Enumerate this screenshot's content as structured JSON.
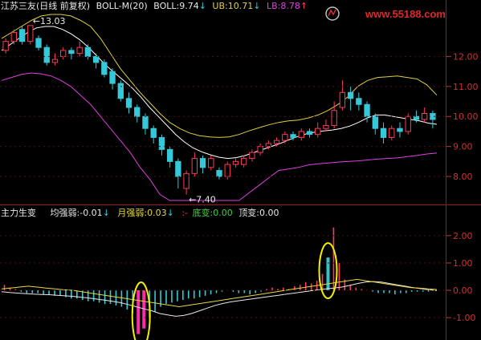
{
  "header": {
    "title": "江苏三友(日线 前复权)",
    "indicator": "BOLL-M(20)",
    "boll_label": "BOLL:",
    "boll_value": "9.74",
    "boll_arrow": "↓",
    "ub_label": "UB:",
    "ub_value": "10.71",
    "ub_arrow": "↓",
    "lb_label": "LB:",
    "lb_value": "8.78",
    "lb_arrow": "↑"
  },
  "sub_header": {
    "title": "主力生变",
    "jqr_label": "均强弱:",
    "jqr_value": "-0.01",
    "jqr_arrow": "↓",
    "yqr_label": "月强弱:",
    "yqr_value": "0.03",
    "yqr_arrow": "↓",
    "sep": ":-",
    "dibian_label": "底变:",
    "dibian_value": "0.00",
    "dingbian_label": "顶变:",
    "dingbian_value": "0.00"
  },
  "watermark": "www.55188.com",
  "colors": {
    "up": "#ff3a5a",
    "down": "#36c8d8",
    "mid": "#ffffff",
    "upper": "#e0d040",
    "lower": "#e040e0",
    "axis": "#a01818",
    "tick": "#d03030",
    "text": "#c8c8c8",
    "highlight": "#f0f000",
    "pink": "#ff2aa8",
    "teal": "#2fc4d0",
    "yellow_line": "#e8d840",
    "green": "#40d040",
    "magenta": "#e040e0"
  },
  "chart_data": [
    {
      "type": "candlestick",
      "title": "江苏三友(日线 前复权)",
      "ylim": [
        7.2,
        13.4
      ],
      "y_ticks": [
        "8.00",
        "9.00",
        "10.00",
        "11.00",
        "12.00"
      ],
      "annotations": [
        {
          "text": "13.03",
          "value": 13.03,
          "kind": "high"
        },
        {
          "text": "7.40",
          "value": 7.4,
          "kind": "low"
        }
      ],
      "mid": [
        12.2,
        12.4,
        12.6,
        12.8,
        12.95,
        13.0,
        13.0,
        12.9,
        12.75,
        12.55,
        12.3,
        12.0,
        11.7,
        11.45,
        11.2,
        10.95,
        10.65,
        10.3,
        10.0,
        9.7,
        9.4,
        9.15,
        8.95,
        8.82,
        8.72,
        8.64,
        8.6,
        8.63,
        8.7,
        8.8,
        8.9,
        9.0,
        9.1,
        9.22,
        9.33,
        9.42,
        9.48,
        9.52,
        9.55,
        9.6,
        9.68,
        9.8,
        9.95,
        10.05,
        10.05,
        10.0,
        9.95,
        9.9,
        9.85,
        9.78,
        9.74
      ],
      "upper": [
        12.6,
        12.8,
        13.0,
        13.2,
        13.35,
        13.4,
        13.4,
        13.35,
        13.2,
        13.0,
        12.6,
        12.1,
        11.6,
        11.2,
        10.8,
        10.45,
        10.1,
        9.8,
        9.6,
        9.45,
        9.36,
        9.32,
        9.3,
        9.32,
        9.4,
        9.52,
        9.62,
        9.72,
        9.8,
        9.85,
        9.88,
        9.95,
        10.05,
        10.2,
        10.4,
        10.65,
        11.0,
        11.2,
        11.3,
        11.32,
        11.35,
        11.3,
        11.25,
        11.05,
        10.71
      ],
      "lower": [
        11.2,
        11.3,
        11.4,
        11.45,
        11.42,
        11.35,
        11.2,
        11.0,
        10.7,
        10.4,
        10.0,
        9.6,
        9.2,
        8.8,
        8.3,
        7.9,
        7.4,
        7.2,
        7.2,
        7.2,
        7.2,
        7.2,
        7.2,
        7.2,
        7.2,
        7.45,
        7.7,
        7.95,
        8.2,
        8.25,
        8.3,
        8.38,
        8.42,
        8.45,
        8.48,
        8.5,
        8.52,
        8.55,
        8.58,
        8.6,
        8.62,
        8.66,
        8.7,
        8.75,
        8.78
      ],
      "candles": [
        [
          12.2,
          12.5,
          12.6,
          12.1
        ],
        [
          12.5,
          12.8,
          12.9,
          12.4
        ],
        [
          12.9,
          12.5,
          13.0,
          12.4
        ],
        [
          12.5,
          13.03,
          13.03,
          12.4
        ],
        [
          12.6,
          12.3,
          12.7,
          12.2
        ],
        [
          12.3,
          11.8,
          12.4,
          11.7
        ],
        [
          11.8,
          11.9,
          12.1,
          11.7
        ],
        [
          12.0,
          12.2,
          12.3,
          11.9
        ],
        [
          12.2,
          12.1,
          12.3,
          11.9
        ],
        [
          12.1,
          12.3,
          12.5,
          12.0
        ],
        [
          12.3,
          12.0,
          12.4,
          11.9
        ],
        [
          12.0,
          11.8,
          12.1,
          11.6
        ],
        [
          11.8,
          11.4,
          11.9,
          11.3
        ],
        [
          11.5,
          11.1,
          11.6,
          10.9
        ],
        [
          11.1,
          10.6,
          11.2,
          10.5
        ],
        [
          10.6,
          10.3,
          10.8,
          10.1
        ],
        [
          10.3,
          10.0,
          10.4,
          9.8
        ],
        [
          10.0,
          9.6,
          10.1,
          9.4
        ],
        [
          9.6,
          9.3,
          9.7,
          9.1
        ],
        [
          9.3,
          8.9,
          9.4,
          8.7
        ],
        [
          8.9,
          8.5,
          9.0,
          8.3
        ],
        [
          8.5,
          8.0,
          8.6,
          7.6
        ],
        [
          7.6,
          8.1,
          8.2,
          7.4
        ],
        [
          8.1,
          8.6,
          8.8,
          8.0
        ],
        [
          8.6,
          8.3,
          8.7,
          8.1
        ],
        [
          8.3,
          8.6,
          8.7,
          8.2
        ],
        [
          8.2,
          8.0,
          8.3,
          7.9
        ],
        [
          8.0,
          8.4,
          8.5,
          7.9
        ],
        [
          8.4,
          8.5,
          8.6,
          8.3
        ],
        [
          8.4,
          8.6,
          8.7,
          8.3
        ],
        [
          8.6,
          8.8,
          8.9,
          8.5
        ],
        [
          8.8,
          9.0,
          9.1,
          8.7
        ],
        [
          9.0,
          9.1,
          9.2,
          8.9
        ],
        [
          9.1,
          9.2,
          9.3,
          9.0
        ],
        [
          9.2,
          9.4,
          9.5,
          9.1
        ],
        [
          9.4,
          9.3,
          9.5,
          9.2
        ],
        [
          9.3,
          9.5,
          9.6,
          9.2
        ],
        [
          9.5,
          9.4,
          9.6,
          9.3
        ],
        [
          9.4,
          9.6,
          9.8,
          9.3
        ],
        [
          9.6,
          9.7,
          9.9,
          9.5
        ],
        [
          9.7,
          10.2,
          10.5,
          9.6
        ],
        [
          10.3,
          10.8,
          11.2,
          10.2
        ],
        [
          10.8,
          10.6,
          11.0,
          10.2
        ],
        [
          10.6,
          10.4,
          10.8,
          10.2
        ],
        [
          10.4,
          10.0,
          10.5,
          9.8
        ],
        [
          10.0,
          9.6,
          10.1,
          9.4
        ],
        [
          9.6,
          9.3,
          9.8,
          9.1
        ],
        [
          9.3,
          9.6,
          9.7,
          9.2
        ],
        [
          9.6,
          9.5,
          9.8,
          9.3
        ],
        [
          9.5,
          10.0,
          10.1,
          9.4
        ],
        [
          10.0,
          9.9,
          10.2,
          9.8
        ],
        [
          9.9,
          10.1,
          10.3,
          9.8
        ],
        [
          10.1,
          9.9,
          10.2,
          9.6
        ]
      ]
    },
    {
      "type": "bar",
      "title": "主力生变",
      "ylim": [
        -1.7,
        2.7
      ],
      "y_ticks": [
        "-1.00",
        "0.00",
        "1.00",
        "2.00"
      ],
      "series": [
        {
          "name": "底变",
          "values": [
            0.2,
            0.1,
            0.05,
            -0.05,
            -0.1,
            -0.1,
            -0.1,
            -0.15,
            -0.15,
            -0.2,
            -0.2,
            -0.25,
            -0.3,
            -0.3,
            -0.35,
            -0.4,
            -0.4,
            -0.45,
            -0.5,
            -0.5,
            -0.55,
            -0.6,
            -0.7,
            -0.85,
            -1.1,
            -1.3,
            -1.0,
            -0.8,
            -0.6,
            -0.5,
            -0.45,
            -0.4,
            -0.35,
            -0.3,
            -0.3,
            -0.25,
            -0.2,
            -0.15,
            -0.1,
            -0.05,
            0.0,
            -0.05,
            -0.1,
            -0.1,
            -0.15,
            -0.1,
            -0.05,
            0.05,
            0.1,
            0.05,
            0.1,
            0.05,
            0.15,
            0.2,
            0.3,
            0.25,
            0.35,
            0.6,
            1.2,
            2.3,
            1.0,
            0.4,
            0.2,
            0.1,
            0.05,
            0.0,
            -0.05,
            -0.1,
            -0.1,
            -0.1,
            -0.15,
            -0.1,
            -0.1,
            -0.05,
            -0.05,
            -0.05,
            -0.05,
            0.0
          ]
        },
        {
          "name": "顶变",
          "values": [
            0,
            0,
            0,
            0,
            0,
            0,
            0,
            0,
            0,
            0,
            0,
            0,
            0,
            0,
            0,
            0,
            0,
            0,
            0,
            0,
            0,
            0,
            0,
            0,
            -1.6,
            -1.4,
            0,
            0,
            0,
            0,
            0,
            0,
            0,
            0,
            0,
            0,
            0,
            0,
            0,
            0,
            0,
            0,
            0,
            0,
            0,
            0,
            0,
            0,
            0,
            0,
            0,
            0,
            0,
            0,
            0,
            0,
            0,
            0,
            1.2,
            0,
            0,
            0,
            0,
            0,
            0,
            0,
            0,
            0,
            0,
            0,
            0,
            0,
            0,
            0,
            0,
            0,
            0,
            0
          ]
        },
        {
          "name": "均强弱",
          "values": [
            -0.05,
            -0.08,
            -0.1,
            -0.12,
            -0.14,
            -0.15,
            -0.16,
            -0.18,
            -0.2,
            -0.22,
            -0.25,
            -0.28,
            -0.32,
            -0.36,
            -0.4,
            -0.45,
            -0.52,
            -0.6,
            -0.68,
            -0.75,
            -0.85,
            -0.9,
            -0.95,
            -0.92,
            -0.85,
            -0.75,
            -0.65,
            -0.55,
            -0.48,
            -0.42,
            -0.38,
            -0.34,
            -0.3,
            -0.26,
            -0.22,
            -0.18,
            -0.14,
            -0.1,
            -0.06,
            -0.02,
            0.02,
            0.05,
            0.08,
            0.12,
            0.18,
            0.25,
            0.3,
            0.32,
            0.3,
            0.25,
            0.2,
            0.15,
            0.1,
            0.06,
            0.02,
            -0.01
          ]
        },
        {
          "name": "月强弱",
          "values": [
            0.05,
            0.08,
            0.12,
            0.15,
            0.12,
            0.08,
            0.05,
            0.02,
            0.0,
            -0.05,
            -0.1,
            -0.15,
            -0.2,
            -0.25,
            -0.3,
            -0.35,
            -0.4,
            -0.45,
            -0.5,
            -0.55,
            -0.6,
            -0.55,
            -0.5,
            -0.45,
            -0.4,
            -0.35,
            -0.3,
            -0.25,
            -0.2,
            -0.15,
            -0.1,
            -0.05,
            0.0,
            0.05,
            0.1,
            0.15,
            0.2,
            0.25,
            0.3,
            0.35,
            0.4,
            0.35,
            0.3,
            0.25,
            0.2,
            0.15,
            0.1,
            0.08,
            0.05,
            0.03
          ]
        }
      ],
      "highlights": [
        "底部变盘",
        "顶部变盘"
      ]
    }
  ]
}
